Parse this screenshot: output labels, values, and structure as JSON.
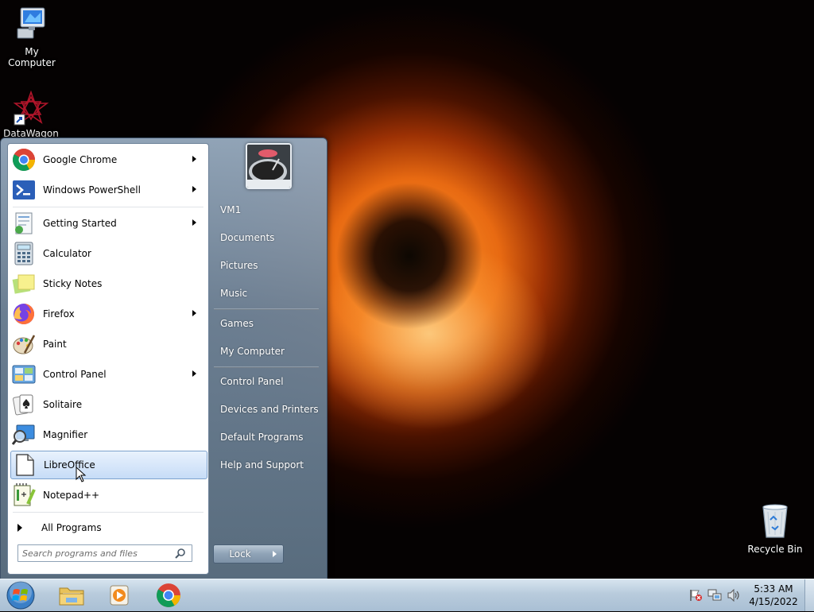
{
  "desktop": {
    "icons": [
      {
        "label": "My Computer",
        "icon": "computer-icon"
      },
      {
        "label": "DataWagon",
        "icon": "datawagon-icon"
      },
      {
        "label": "Recycle Bin",
        "icon": "recycle-bin-icon"
      }
    ]
  },
  "start_menu": {
    "programs": [
      {
        "label": "Google Chrome",
        "icon": "chrome-icon",
        "submenu": true
      },
      {
        "label": "Windows PowerShell",
        "icon": "powershell-icon",
        "submenu": true
      },
      {
        "label": "Getting Started",
        "icon": "getting-started-icon",
        "submenu": true
      },
      {
        "label": "Calculator",
        "icon": "calculator-icon",
        "submenu": false
      },
      {
        "label": "Sticky Notes",
        "icon": "sticky-notes-icon",
        "submenu": false
      },
      {
        "label": "Firefox",
        "icon": "firefox-icon",
        "submenu": true
      },
      {
        "label": "Paint",
        "icon": "paint-icon",
        "submenu": false
      },
      {
        "label": "Control Panel",
        "icon": "control-panel-icon",
        "submenu": true
      },
      {
        "label": "Solitaire",
        "icon": "solitaire-icon",
        "submenu": false
      },
      {
        "label": "Magnifier",
        "icon": "magnifier-icon",
        "submenu": false
      },
      {
        "label": "LibreOffice",
        "icon": "libreoffice-icon",
        "submenu": false,
        "selected": true
      },
      {
        "label": "Notepad++",
        "icon": "notepadpp-icon",
        "submenu": false
      }
    ],
    "all_programs": "All Programs",
    "search_placeholder": "Search programs and files",
    "right_items": [
      {
        "label": "VM1"
      },
      {
        "label": "Documents"
      },
      {
        "label": "Pictures"
      },
      {
        "label": "Music"
      },
      {
        "label": "Games"
      },
      {
        "label": "My Computer"
      },
      {
        "label": "Control Panel"
      },
      {
        "label": "Devices and Printers"
      },
      {
        "label": "Default Programs"
      },
      {
        "label": "Help and Support"
      }
    ],
    "lock_label": "Lock"
  },
  "taskbar": {
    "pinned": [
      "file-explorer-icon",
      "media-player-icon",
      "chrome-icon"
    ],
    "tray_icons": [
      "action-center-flag-icon",
      "network-icon",
      "volume-icon"
    ],
    "clock_time": "5:33 AM",
    "clock_date": "4/15/2022"
  },
  "colors": {
    "selection_bg": "#c6dcf7",
    "selection_border": "#7da2ce",
    "taskbar": "#b8cbdc"
  }
}
